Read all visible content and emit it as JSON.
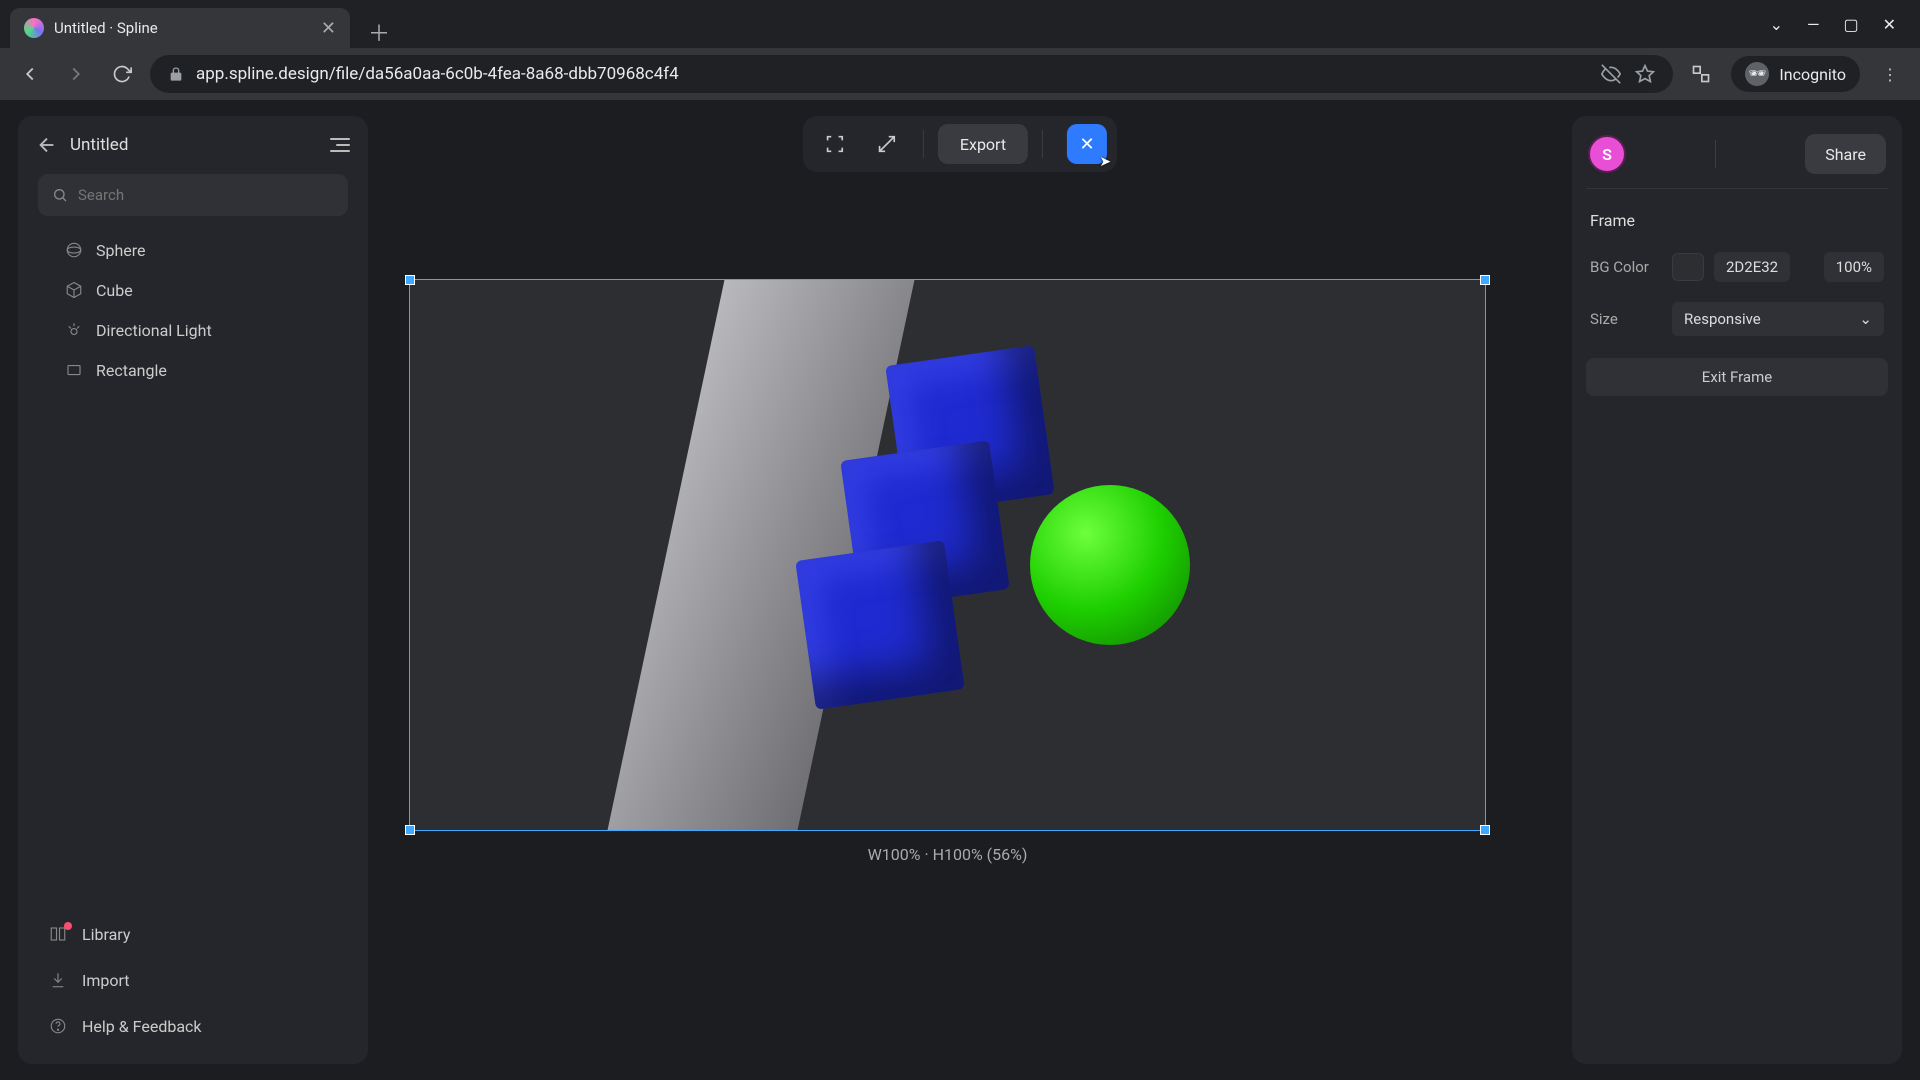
{
  "browser": {
    "tab_title": "Untitled · Spline",
    "url": "app.spline.design/file/da56a0aa-6c0b-4fea-8a68-dbb70968c4f4",
    "incognito_label": "Incognito"
  },
  "doc": {
    "title": "Untitled"
  },
  "search": {
    "placeholder": "Search"
  },
  "layers": [
    {
      "name": "Sphere",
      "icon": "sphere"
    },
    {
      "name": "Cube",
      "icon": "cube"
    },
    {
      "name": "Directional Light",
      "icon": "light"
    },
    {
      "name": "Rectangle",
      "icon": "rect"
    }
  ],
  "left_footer": {
    "library": "Library",
    "import": "Import",
    "help": "Help & Feedback"
  },
  "toolbar": {
    "export": "Export"
  },
  "right": {
    "avatar_initial": "S",
    "share": "Share",
    "section": "Frame",
    "bg_label": "BG Color",
    "bg_hex": "2D2E32",
    "bg_opacity": "100%",
    "size_label": "Size",
    "size_value": "Responsive",
    "exit": "Exit Frame"
  },
  "frame": {
    "info": "W100% · H100% (56%)"
  }
}
